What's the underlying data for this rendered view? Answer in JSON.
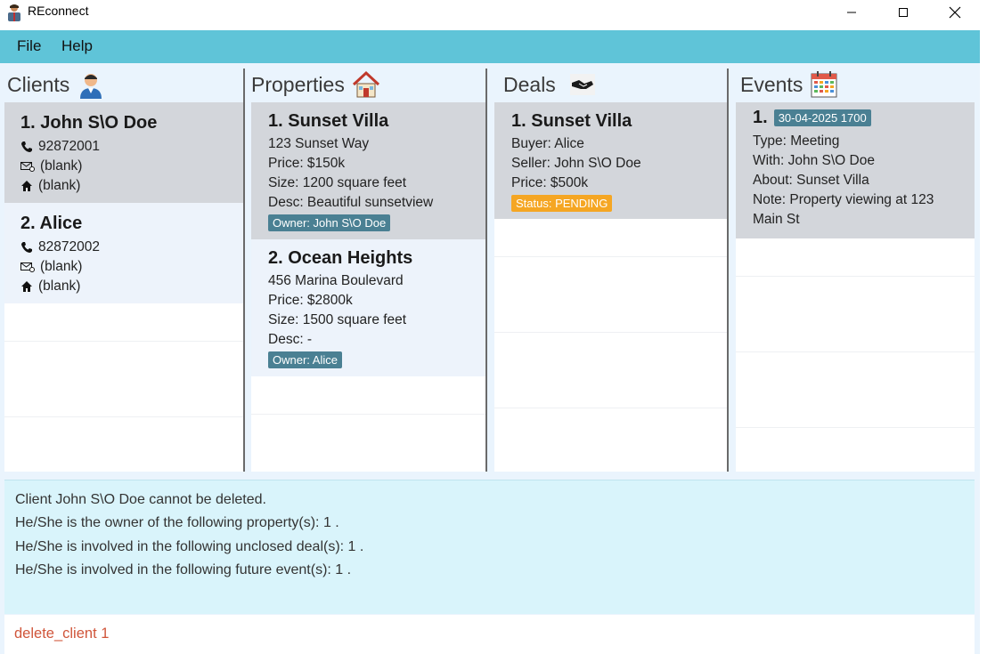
{
  "window": {
    "title": "REconnect",
    "icon": "person-icon"
  },
  "menu": {
    "file": "File",
    "help": "Help"
  },
  "columns": {
    "clients": {
      "title": "Clients",
      "icon": "person-icon"
    },
    "properties": {
      "title": "Properties",
      "icon": "house-icon"
    },
    "deals": {
      "title": "Deals",
      "icon": "handshake-icon"
    },
    "events": {
      "title": "Events",
      "icon": "calendar-icon"
    }
  },
  "clients": [
    {
      "title": "1. John S\\O Doe",
      "phone": "92872001",
      "email": "(blank)",
      "address": "(blank)"
    },
    {
      "title": "2. Alice",
      "phone": "82872002",
      "email": "(blank)",
      "address": "(blank)"
    }
  ],
  "properties": [
    {
      "title": "1. Sunset Villa",
      "address": "123 Sunset Way",
      "price": "Price: $150k",
      "size": "Size: 1200 square feet",
      "desc": "Desc: Beautiful sunsetview",
      "owner": "Owner: John S\\O Doe"
    },
    {
      "title": "2. Ocean Heights",
      "address": "456 Marina Boulevard",
      "price": "Price: $2800k",
      "size": "Size: 1500 square feet",
      "desc": "Desc: -",
      "owner": "Owner: Alice"
    }
  ],
  "deals": [
    {
      "title": "1. Sunset Villa",
      "buyer": "Buyer: Alice",
      "seller": "Seller: John S\\O Doe",
      "price": "Price: $500k",
      "status": "Status: PENDING"
    }
  ],
  "events": [
    {
      "index": "1.",
      "datetime": "30-04-2025 1700",
      "type": "Type: Meeting",
      "with": "With: John S\\O Doe",
      "about": "About: Sunset Villa",
      "note": "Note: Property viewing at 123 Main St"
    }
  ],
  "result": {
    "lines": [
      "Client John S\\O Doe cannot be deleted.",
      "He/She is the owner of the following property(s): 1 .",
      "He/She is involved in the following unclosed deal(s): 1 .",
      "He/She is involved in the following future event(s): 1 ."
    ]
  },
  "command": {
    "value": "delete_client 1"
  },
  "colors": {
    "menubar": "#5fc4d8",
    "badge": "#4a8093",
    "status_pending": "#f5a623",
    "result_bg": "#d9f4fb",
    "command_text": "#d0553a"
  }
}
